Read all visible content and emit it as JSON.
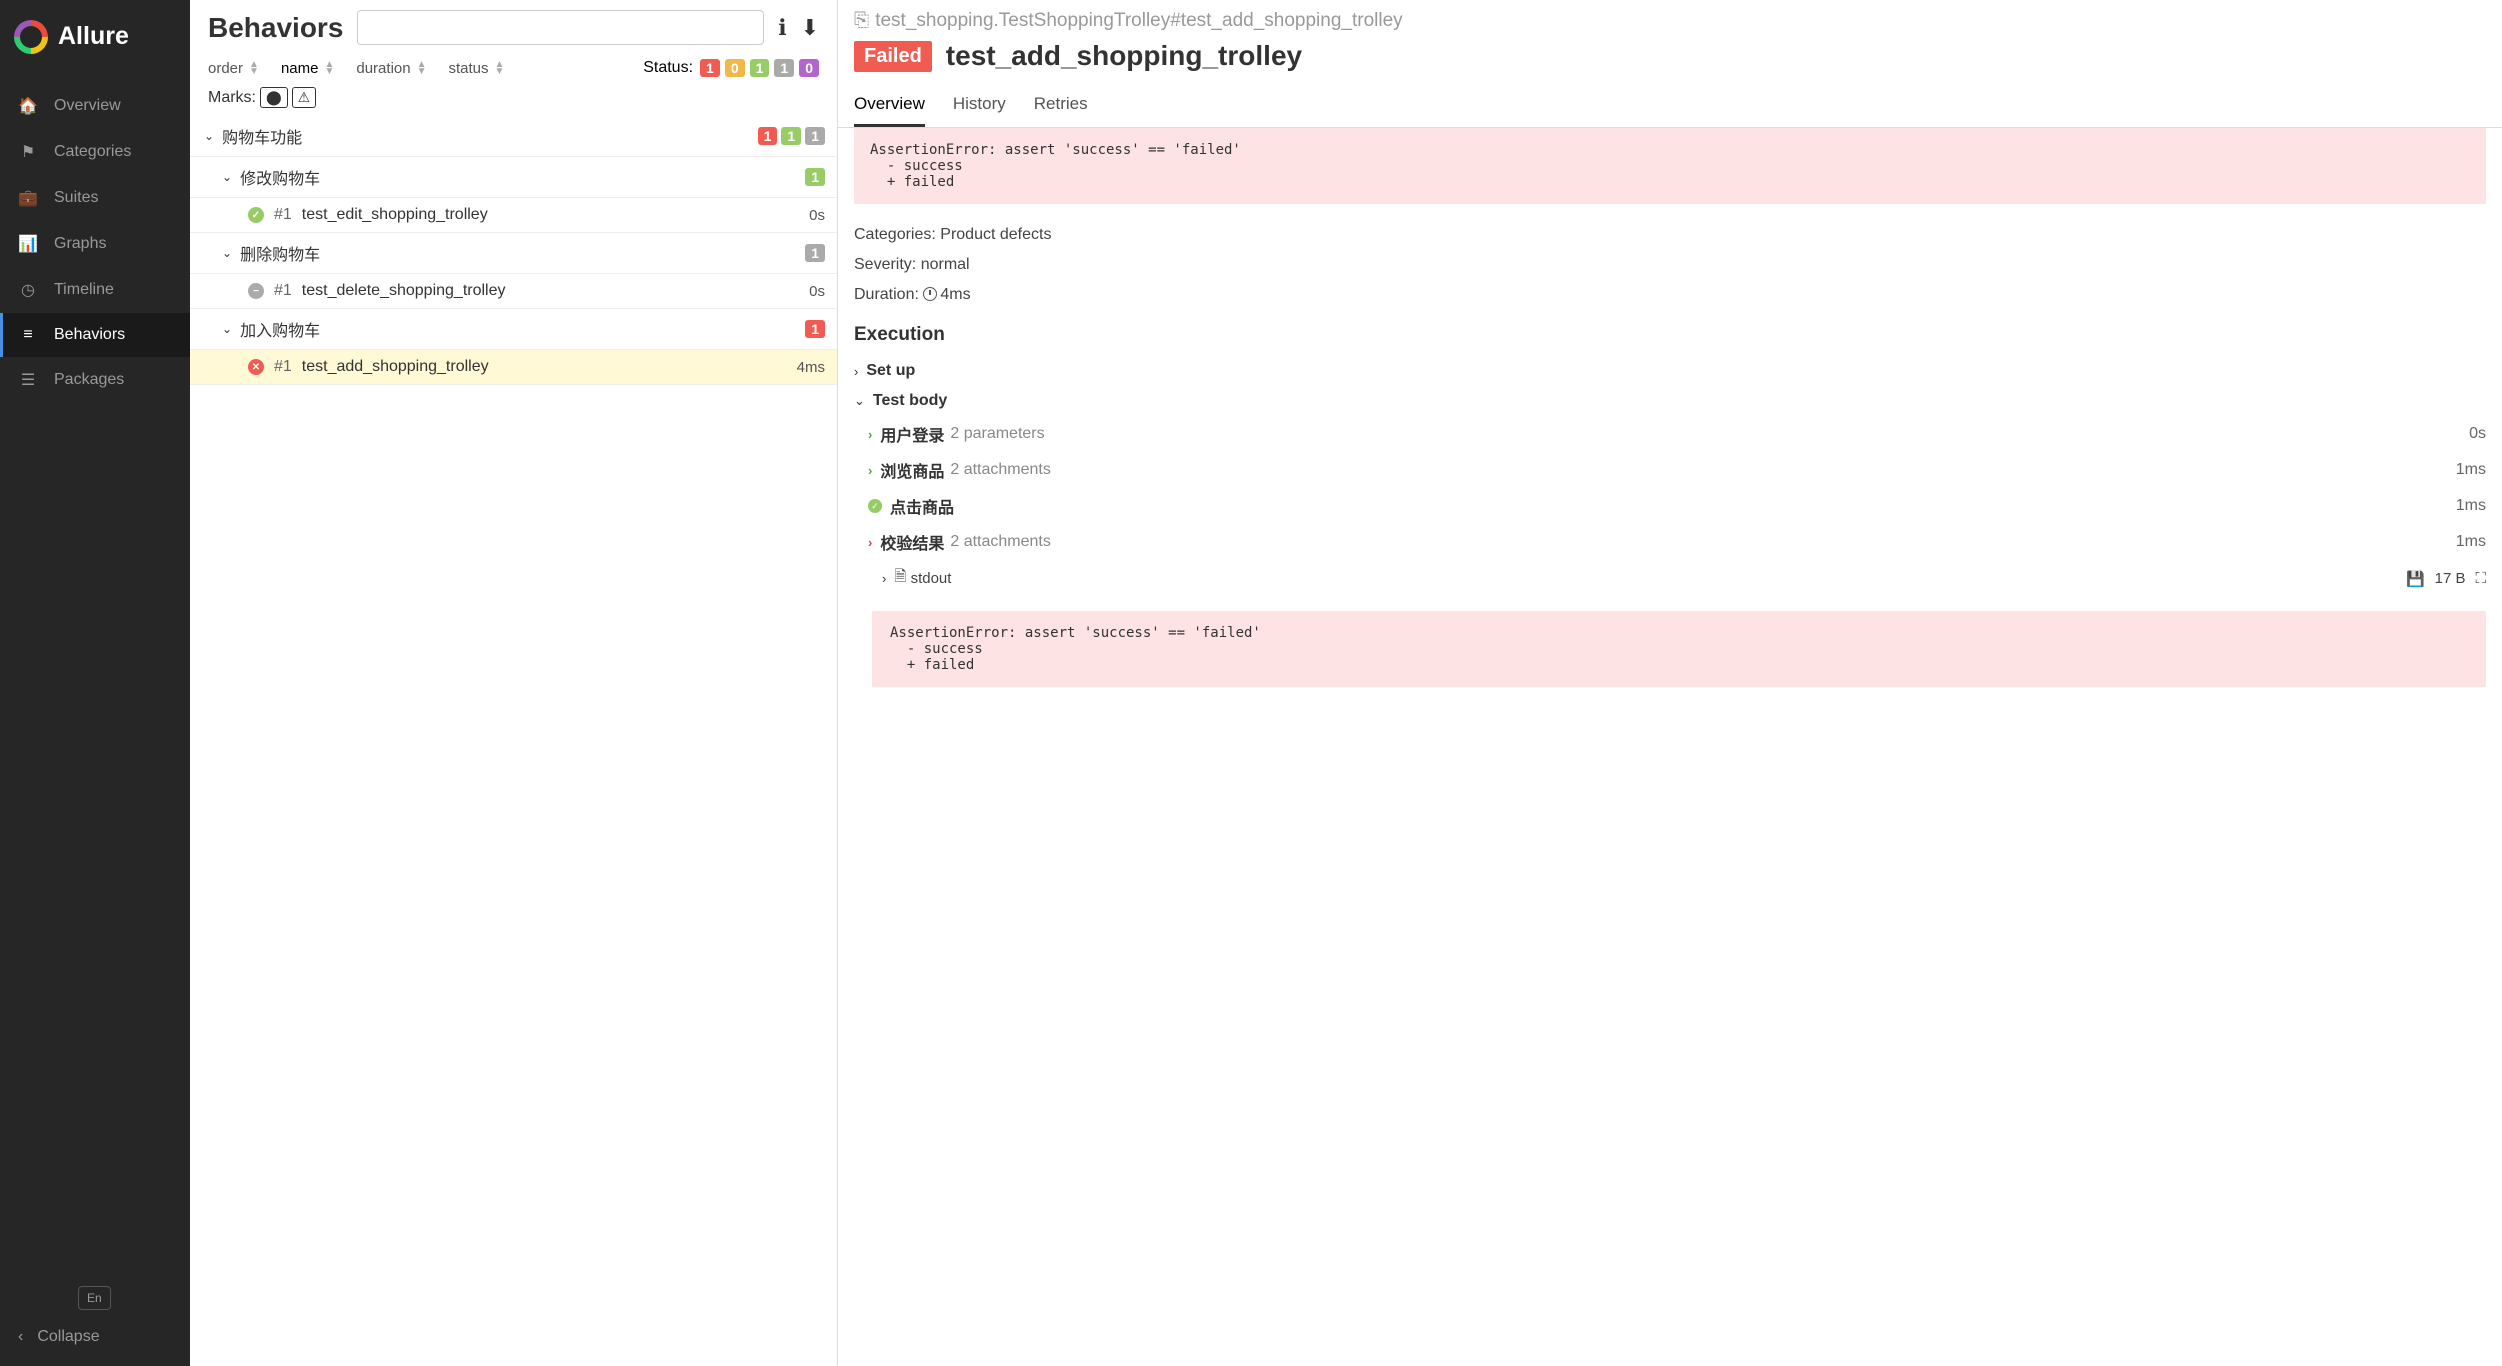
{
  "brand": "Allure",
  "nav": {
    "overview": "Overview",
    "categories": "Categories",
    "suites": "Suites",
    "graphs": "Graphs",
    "timeline": "Timeline",
    "behaviors": "Behaviors",
    "packages": "Packages"
  },
  "lang": "En",
  "collapse": "Collapse",
  "mid": {
    "title": "Behaviors",
    "sorters": {
      "order": "order",
      "name": "name",
      "duration": "duration",
      "status": "status"
    },
    "status_label": "Status:",
    "status_counts": {
      "fail": "1",
      "broken": "0",
      "pass": "1",
      "skip": "1",
      "unknown": "0"
    },
    "marks_label": "Marks:"
  },
  "tree": {
    "g1": {
      "name": "购物车功能",
      "badges": {
        "fail": "1",
        "pass": "1",
        "skip": "1"
      }
    },
    "g2a": {
      "name": "修改购物车",
      "badge": "1"
    },
    "t1": {
      "num": "#1",
      "name": "test_edit_shopping_trolley",
      "dur": "0s"
    },
    "g2b": {
      "name": "删除购物车",
      "badge": "1"
    },
    "t2": {
      "num": "#1",
      "name": "test_delete_shopping_trolley",
      "dur": "0s"
    },
    "g2c": {
      "name": "加入购物车",
      "badge": "1"
    },
    "t3": {
      "num": "#1",
      "name": "test_add_shopping_trolley",
      "dur": "4ms"
    }
  },
  "detail": {
    "path": "test_shopping.TestShoppingTrolley#test_add_shopping_trolley",
    "status": "Failed",
    "title": "test_add_shopping_trolley",
    "tabs": {
      "overview": "Overview",
      "history": "History",
      "retries": "Retries"
    },
    "error": "AssertionError: assert 'success' == 'failed'\n  - success\n  + failed",
    "categories_label": "Categories:",
    "categories_val": "Product defects",
    "severity_label": "Severity:",
    "severity_val": "normal",
    "duration_label": "Duration:",
    "duration_val": "4ms",
    "execution": "Execution",
    "setup": "Set up",
    "testbody": "Test body",
    "steps": {
      "s1": {
        "name": "用户登录",
        "sub": "2 parameters",
        "dur": "0s"
      },
      "s2": {
        "name": "浏览商品",
        "sub": "2 attachments",
        "dur": "1ms"
      },
      "s3": {
        "name": "点击商品",
        "dur": "1ms"
      },
      "s4": {
        "name": "校验结果",
        "sub": "2 attachments",
        "dur": "1ms"
      }
    },
    "attach": {
      "name": "stdout",
      "size": "17 B"
    },
    "error2": "AssertionError: assert 'success' == 'failed'\n  - success\n  + failed"
  }
}
